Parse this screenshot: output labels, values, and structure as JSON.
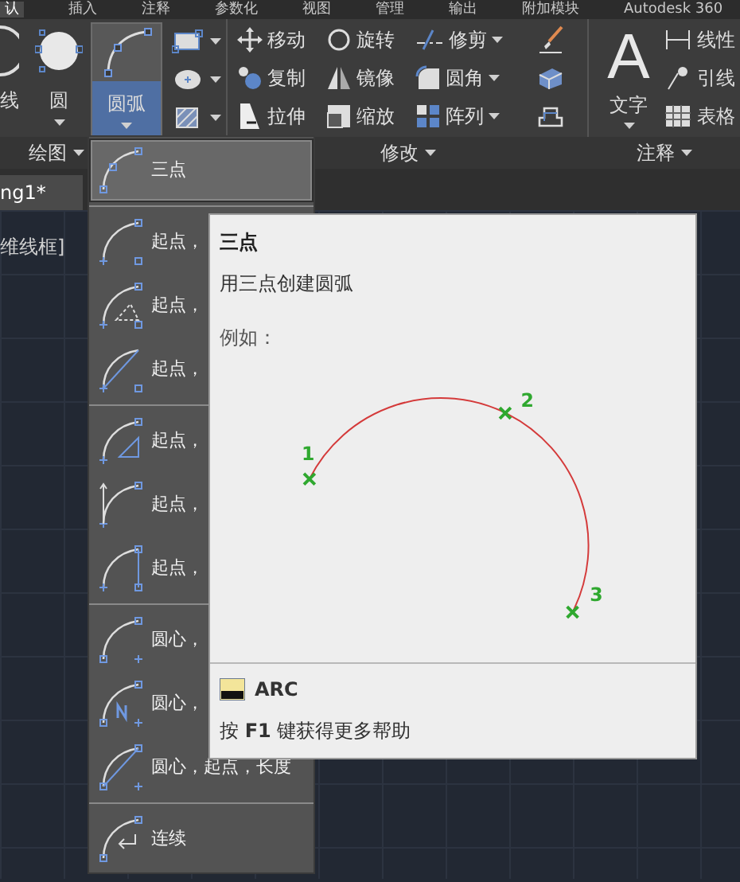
{
  "ribbon_tabs": [
    {
      "label": "认",
      "selected": true
    },
    {
      "label": "插入",
      "selected": false
    },
    {
      "label": "注释",
      "selected": false
    },
    {
      "label": "参数化",
      "selected": false
    },
    {
      "label": "视图",
      "selected": false
    },
    {
      "label": "管理",
      "selected": false
    },
    {
      "label": "输出",
      "selected": false
    },
    {
      "label": "附加模块",
      "selected": false
    },
    {
      "label": "Autodesk 360",
      "selected": false
    }
  ],
  "draw_panel": {
    "title": "绘图",
    "large_buttons": [
      {
        "label": "线",
        "kind": "line",
        "selected": false
      },
      {
        "label": "圆",
        "kind": "circle",
        "selected": false
      },
      {
        "label": "圆弧",
        "kind": "arc",
        "selected": true
      }
    ],
    "small_tools": [
      {
        "kind": "rectangle"
      },
      {
        "kind": "ellipse"
      },
      {
        "kind": "hatch"
      }
    ]
  },
  "modify_panel": {
    "title": "修改",
    "tools": [
      {
        "label": "移动",
        "kind": "move",
        "dropdown": false
      },
      {
        "label": "旋转",
        "kind": "rotate",
        "dropdown": false
      },
      {
        "label": "修剪",
        "kind": "trim",
        "dropdown": true
      },
      {
        "label": "复制",
        "kind": "copy",
        "dropdown": false
      },
      {
        "label": "镜像",
        "kind": "mirror",
        "dropdown": false
      },
      {
        "label": "圆角",
        "kind": "fillet",
        "dropdown": true
      },
      {
        "label": "拉伸",
        "kind": "stretch",
        "dropdown": false
      },
      {
        "label": "缩放",
        "kind": "scale",
        "dropdown": false
      },
      {
        "label": "阵列",
        "kind": "array",
        "dropdown": true
      }
    ],
    "icon_tools": [
      {
        "kind": "brush"
      },
      {
        "kind": "solid"
      },
      {
        "kind": "offset"
      }
    ]
  },
  "annotation_panel": {
    "title": "注释",
    "large_button": {
      "label": "文字",
      "glyph": "A"
    },
    "tools": [
      {
        "label": "线性",
        "kind": "dimension"
      },
      {
        "label": "引线",
        "kind": "leader"
      },
      {
        "label": "表格",
        "kind": "table"
      }
    ]
  },
  "file_tab": "ng1*",
  "viewport_label": "维线框]",
  "arc_menu": {
    "groups": [
      {
        "items": [
          {
            "label": "三点",
            "kind": "three-point",
            "selected": true
          }
        ]
      },
      {
        "items": [
          {
            "label": "起点，",
            "kind": "start-center-end",
            "selected": false
          },
          {
            "label": "起点，",
            "kind": "start-center-angle",
            "selected": false
          },
          {
            "label": "起点，",
            "kind": "start-center-length",
            "selected": false
          }
        ]
      },
      {
        "items": [
          {
            "label": "起点，",
            "kind": "start-end-angle",
            "selected": false
          },
          {
            "label": "起点，",
            "kind": "start-end-direction",
            "selected": false
          },
          {
            "label": "起点，",
            "kind": "start-end-radius",
            "selected": false
          }
        ]
      },
      {
        "items": [
          {
            "label": "圆心，",
            "kind": "center-start-end",
            "selected": false
          },
          {
            "label": "圆心，",
            "kind": "center-start-angle",
            "selected": false
          },
          {
            "label": "圆心，起点，长度",
            "kind": "center-start-length",
            "selected": false
          }
        ]
      },
      {
        "items": [
          {
            "label": "连续",
            "kind": "continue",
            "selected": false
          }
        ]
      }
    ]
  },
  "tooltip": {
    "title": "三点",
    "description": "用三点创建圆弧",
    "example_label": "例如：",
    "point_labels": [
      "1",
      "2",
      "3"
    ],
    "command": "ARC",
    "help": "按 **F1** 键获得更多帮助"
  }
}
